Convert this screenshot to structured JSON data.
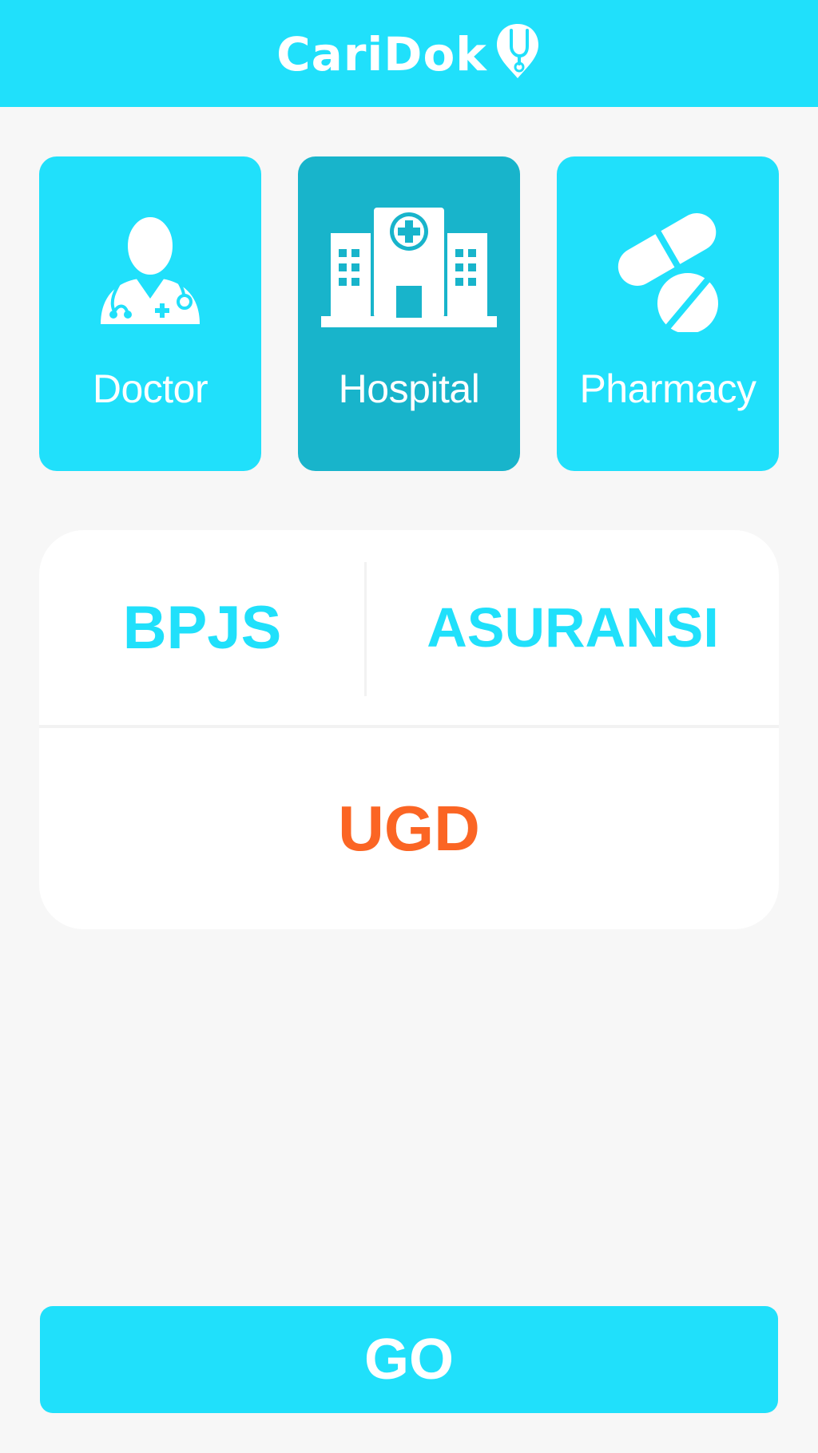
{
  "app": {
    "name": "CariDok",
    "logo_icon": "stethoscope-pin-icon",
    "brand_color": "#20e0fb",
    "selected_color": "#18b4cb",
    "accent_color": "#fb6524"
  },
  "categories": [
    {
      "label": "Doctor",
      "icon": "doctor-icon",
      "selected": false
    },
    {
      "label": "Hospital",
      "icon": "hospital-icon",
      "selected": true
    },
    {
      "label": "Pharmacy",
      "icon": "pills-icon",
      "selected": false
    }
  ],
  "options": {
    "bpjs": "BPJS",
    "asuransi": "ASURANSI",
    "ugd": "UGD"
  },
  "go_button": "GO"
}
